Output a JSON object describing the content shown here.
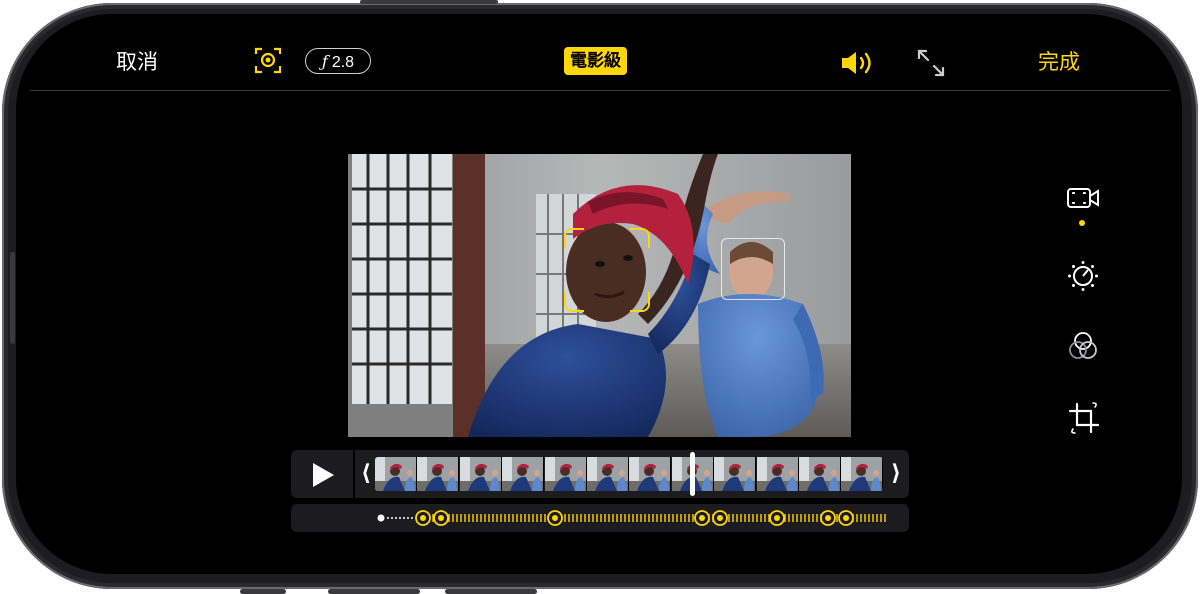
{
  "topbar": {
    "cancel_label": "取消",
    "done_label": "完成",
    "aperture_symbol": "ƒ",
    "aperture_value": "2.8",
    "mode_badge": "電影級"
  },
  "icons": {
    "focus_lock": "focus-lock-icon",
    "speaker": "speaker-icon",
    "expand": "expand-icon",
    "play": "play-icon",
    "video_tool": "video-camera-icon",
    "adjust_tool": "exposure-dial-icon",
    "filter_tool": "filters-icon",
    "crop_tool": "crop-rotate-icon"
  },
  "colors": {
    "accent": "#ffd60a",
    "background": "#000000",
    "panel": "#1c1c1e"
  },
  "timeline": {
    "left_bracket": "⟨",
    "right_bracket": "⟩",
    "playhead_position": 0.63
  },
  "side_tools": {
    "selected": "video-camera-icon"
  }
}
